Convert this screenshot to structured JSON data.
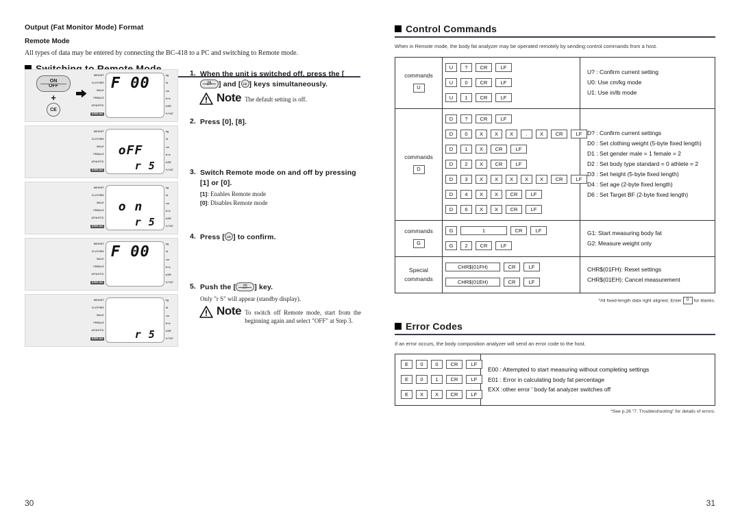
{
  "left_page": {
    "number": "30",
    "heading": "Output (Fat Monitor Mode) Format",
    "subheading": "Remote Mode",
    "intro": "All types of data may be entered by connecting the BC-418 to a PC and switching to Remote mode.",
    "section_title": "Switching to Remote Mode",
    "lcd_left_labels": [
      "WEIGHT",
      "CLOTHES",
      "MALE",
      "FEMALE",
      "ATHLETIC",
      "STEP-ON"
    ],
    "lcd_right_labels": [
      "kg",
      "lb",
      "cm",
      "ft.in",
      "AGE",
      "% FAT"
    ],
    "keys": {
      "on": "ON",
      "off": "OFF",
      "plus": "+",
      "ce": "CE"
    },
    "panels": [
      {
        "has_keys": true,
        "top": "F  00",
        "mid": "",
        "bottom": ""
      },
      {
        "has_keys": false,
        "top": "",
        "mid": "oFF",
        "bottom": "r 5"
      },
      {
        "has_keys": false,
        "top": "",
        "mid": "o n",
        "bottom": "r 5"
      },
      {
        "has_keys": false,
        "top": "F  00",
        "mid": "",
        "bottom": ""
      },
      {
        "has_keys": false,
        "top": "",
        "mid": "",
        "bottom": "r 5"
      }
    ],
    "steps": [
      {
        "num": "1.",
        "title_a": "When the unit is switched off, press the [",
        "title_b": "] and [",
        "title_c": "] keys simultaneously.",
        "note_word": "Note",
        "note_text": "The default setting is off."
      },
      {
        "num": "2.",
        "title": "Press [0],  [8]."
      },
      {
        "num": "3.",
        "title": "Switch Remote mode on and off by pressing [1] or  [0].",
        "sub1_key": "[1]",
        "sub1_text": ": Enables Remote mode",
        "sub2_key": "[0]",
        "sub2_text": ": Disables Remote mode"
      },
      {
        "num": "4.",
        "title_a": "Press [",
        "title_b": "] to confirm."
      },
      {
        "num": "5.",
        "title_a": "Push the [",
        "title_b": "] key.",
        "sub": "Only \"r S\" will appear (standby display).",
        "note_word": "Note",
        "note_text": "To switch off Remote mode, start from the beginning again and select \"OFF\" at Step 3."
      }
    ]
  },
  "right_page": {
    "number": "31",
    "control_commands": {
      "section_title": "Control Commands",
      "intro": "When in Remote mode, the body fat analyzer may be operated remotely by sending control commands from a host.",
      "rows": [
        {
          "label_text": "commands",
          "label_box": "U",
          "sequences": [
            [
              "U",
              "?",
              "CR",
              "LF"
            ],
            [
              "U",
              "0",
              "CR",
              "LF"
            ],
            [
              "U",
              "1",
              "CR",
              "LF"
            ]
          ],
          "descriptions": [
            "U? :  Confirm current setting",
            "U0: Use cm/kg mode",
            "U1: Use in/lb mode"
          ]
        },
        {
          "label_text": "commands",
          "label_box": "D",
          "sequences": [
            [
              "D",
              "?",
              "CR",
              "LF"
            ],
            [
              "D",
              "0",
              "X",
              "X",
              "X",
              ".",
              "X",
              "CR",
              "LF"
            ],
            [
              "D",
              "1",
              "X",
              "CR",
              "LF"
            ],
            [
              "D",
              "2",
              "X",
              "CR",
              "LF"
            ],
            [
              "D",
              "3",
              "X",
              "X",
              "X",
              "X",
              "X",
              "CR",
              "LF"
            ],
            [
              "D",
              "4",
              "X",
              "X",
              "CR",
              "LF"
            ],
            [
              "D",
              "6",
              "X",
              "X",
              "CR",
              "LF"
            ]
          ],
          "descriptions": [
            "D? : Confirm current settings",
            "D0 : Set clothing weight (5-byte fixed length)",
            "D1 : Set gender    male = 1     female = 2",
            "D2 : Set body type  standard = 0   athlete = 2",
            "D3 : Set height (5-byte fixed length)",
            "D4 : Set age (2-byte fixed length)",
            "D6 : Set Target BF (2-byte fixed length)"
          ]
        },
        {
          "label_text": "commands",
          "label_box": "G",
          "sequences": [
            [
              "G",
              "__1__",
              "CR",
              "LF"
            ],
            [
              "G",
              "2",
              "CR",
              "LF"
            ]
          ],
          "descriptions": [
            "G1: Start measuring body fat",
            "G2: Measure weight only"
          ]
        },
        {
          "label_text": "Special",
          "label_text2": "commands",
          "sequences": [
            [
              "CHR$(01FH)",
              "CR",
              "LF"
            ],
            [
              "CHR$(01EH)",
              "CR",
              "LF"
            ]
          ],
          "descriptions": [
            "CHR$(01FH): Reset settings",
            "CHR$(01EH): Cancel measurement"
          ]
        }
      ],
      "footnote_a": "*All fixed-length data right aligned. Enter",
      "footnote_box": "0",
      "footnote_b": "for blanks."
    },
    "error_codes": {
      "section_title": "Error Codes",
      "intro": "If an error occurs, the body composition analyzer will send an error code to the host.",
      "sequences": [
        [
          "E",
          "0",
          "0",
          "CR",
          "LF"
        ],
        [
          "E",
          "0",
          "1",
          "CR",
          "LF"
        ],
        [
          "E",
          "X",
          "X",
          "CR",
          "LF"
        ]
      ],
      "descriptions": [
        "E00 : Attempted to start measuring without completing settings",
        "E01 : Error in calculating body fat percentage",
        "EXX :other error ' body fat analyzer switches off"
      ],
      "footnote": "*See p.26 \"7. Troubleshooting\" for details of errors."
    }
  }
}
